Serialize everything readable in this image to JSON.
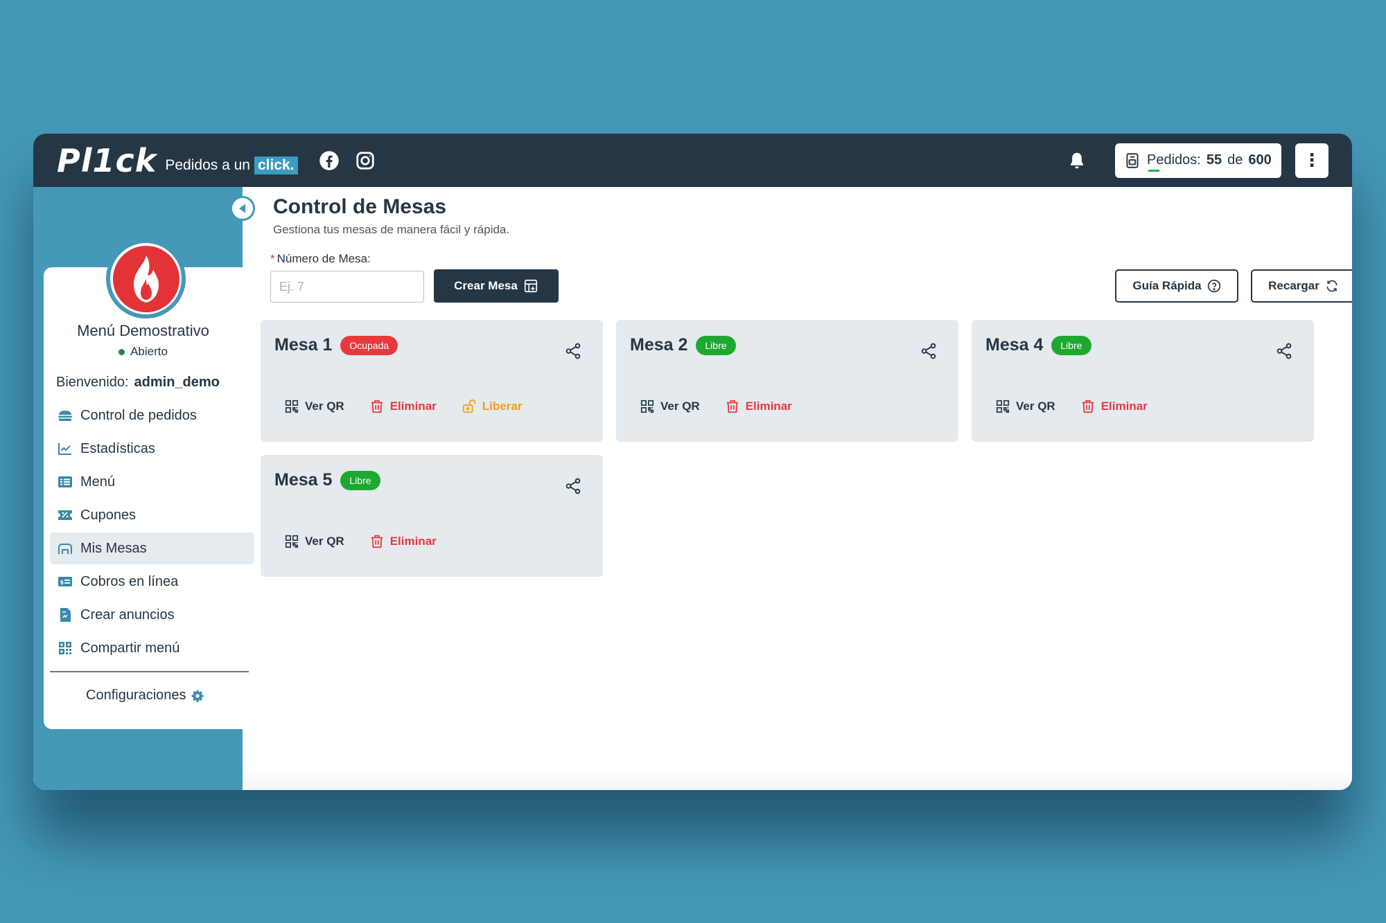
{
  "header": {
    "logo": "Pl1ck",
    "tagline": "Pedidos a un",
    "tagline_highlight": "click.",
    "orders_label": "Pedidos:",
    "orders_used": "55",
    "orders_of": "de",
    "orders_limit": "600"
  },
  "sidebar": {
    "restaurant_name": "Menú Demostrativo",
    "status": "Abierto",
    "welcome_label": "Bienvenido:",
    "username": "admin_demo",
    "items": [
      {
        "label": "Control de pedidos",
        "icon": "burger-icon"
      },
      {
        "label": "Estadísticas",
        "icon": "chart-line-icon"
      },
      {
        "label": "Menú",
        "icon": "list-icon"
      },
      {
        "label": "Cupones",
        "icon": "coupon-icon"
      },
      {
        "label": "Mis Mesas",
        "icon": "table-icon",
        "active": true
      },
      {
        "label": "Cobros en línea",
        "icon": "money-icon"
      },
      {
        "label": "Crear anuncios",
        "icon": "announcement-icon"
      },
      {
        "label": "Compartir menú",
        "icon": "qr-icon"
      }
    ],
    "config_label": "Configuraciones"
  },
  "main": {
    "title": "Control de Mesas",
    "subtitle": "Gestiona tus mesas de manera fácil y rápida.",
    "field_label": "Número de Mesa:",
    "field_placeholder": "Ej. 7",
    "create_button": "Crear Mesa",
    "guide_button": "Guía Rápida",
    "reload_button": "Recargar",
    "tables": [
      {
        "name": "Mesa 1",
        "status": "Ocupada",
        "actions": [
          "Ver QR",
          "Eliminar",
          "Liberar"
        ]
      },
      {
        "name": "Mesa 2",
        "status": "Libre",
        "actions": [
          "Ver QR",
          "Eliminar"
        ]
      },
      {
        "name": "Mesa 4",
        "status": "Libre",
        "actions": [
          "Ver QR",
          "Eliminar"
        ]
      },
      {
        "name": "Mesa 5",
        "status": "Libre",
        "actions": [
          "Ver QR",
          "Eliminar"
        ]
      }
    ]
  },
  "colors": {
    "header_bg": "#253645",
    "accent": "#4598b8",
    "busy": "#e8393d",
    "free": "#1fa82f",
    "release": "#f29d1b"
  }
}
